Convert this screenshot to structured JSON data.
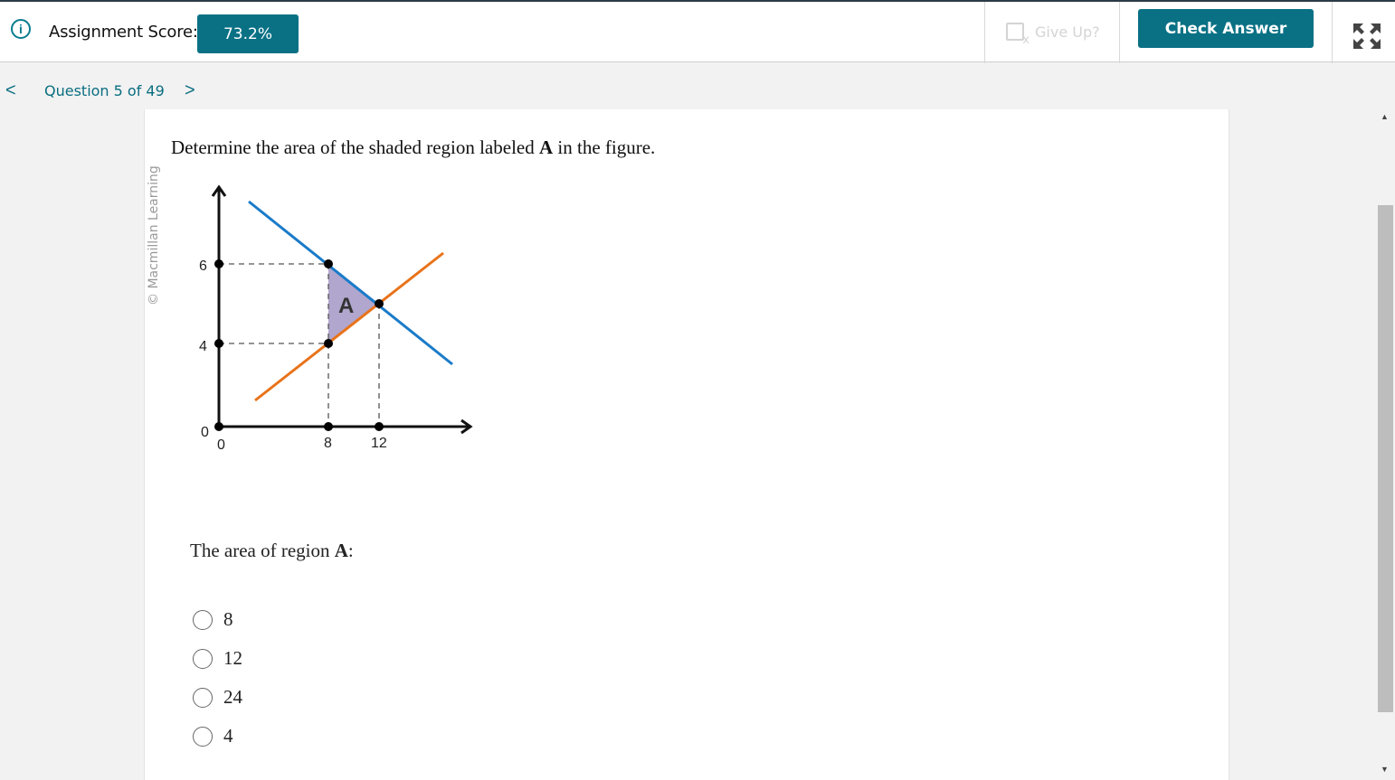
{
  "header": {
    "score_label": "Assignment Score:",
    "score_value": "73.2%",
    "give_up_label": "Give Up?",
    "check_answer_label": "Check Answer"
  },
  "nav": {
    "prev": "<",
    "title": "Question 5 of 49",
    "next": ">"
  },
  "content": {
    "copyright": "© Macmillan Learning",
    "question_pre": "Determine the area of the shaded region labeled ",
    "question_bold": "A",
    "question_post": " in the figure.",
    "answer_pre": "The area of region ",
    "answer_bold": "A",
    "answer_post": ":",
    "choices": [
      "8",
      "12",
      "24",
      "4"
    ]
  },
  "graph": {
    "region_label": "A",
    "x_ticks": [
      "0",
      "8",
      "12"
    ],
    "y_ticks": [
      "0",
      "4",
      "6"
    ],
    "colors": {
      "decreasing_line": "#1a7bc9",
      "increasing_line": "#e8731a",
      "shaded_region": "#a89cc8",
      "dashed": "#555555"
    }
  }
}
